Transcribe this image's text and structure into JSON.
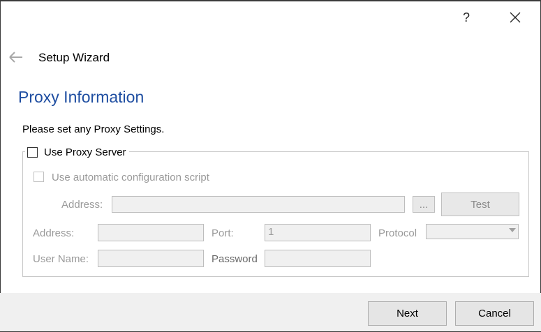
{
  "titlebar": {
    "help": "?",
    "close": "✕"
  },
  "header": {
    "back_icon": "arrow-left-icon",
    "title": "Setup Wizard"
  },
  "page": {
    "title": "Proxy Information",
    "instruction": "Please set any Proxy Settings."
  },
  "proxy": {
    "use_proxy_label": "Use Proxy Server",
    "use_proxy_checked": false,
    "auto_config_label": "Use automatic configuration script",
    "auto_config_checked": false,
    "script_address_label": "Address:",
    "script_address_value": "",
    "browse_label": "...",
    "test_label": "Test",
    "address_label": "Address:",
    "address_value": "",
    "port_label": "Port:",
    "port_value": "1",
    "protocol_label": "Protocol",
    "protocol_value": "",
    "username_label": "User Name:",
    "username_value": "",
    "password_label": "Password",
    "password_value": ""
  },
  "footer": {
    "next_label": "Next",
    "cancel_label": "Cancel"
  },
  "colors": {
    "title_blue": "#1f4ea1",
    "disabled_text": "#9a9a9a",
    "footer_bg": "#f0f0f0"
  }
}
